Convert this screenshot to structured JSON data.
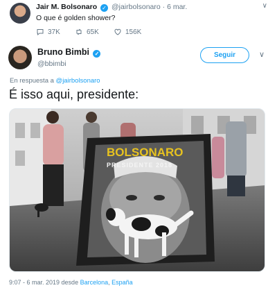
{
  "quoted": {
    "name": "Jair M. Bolsonaro",
    "handle": "@jairbolsonaro",
    "date": "· 6 mar.",
    "text": "O que é golden shower?",
    "replies": "37K",
    "retweets": "65K",
    "likes": "156K"
  },
  "main": {
    "name": "Bruno Bimbi",
    "handle": "@bbimbi",
    "follow_label": "Seguir",
    "reply_prefix": "En respuesta a",
    "reply_handle": "@jairbolsonaro",
    "text": "É isso aqui, presidente:",
    "media": {
      "sign_line1": "BOLSONARO",
      "sign_line2": "PRESIDENTE 2018"
    },
    "time": "9:07 - 6 mar. 2019 desde",
    "place_city": "Barcelona",
    "place_sep": ",",
    "place_country": "España"
  },
  "icons": {
    "verified": "verified-check-icon",
    "reply": "reply-bubble-icon",
    "retweet": "retweet-arrows-icon",
    "like": "heart-icon",
    "more": "chevron-down-icon"
  },
  "colors": {
    "accent": "#1da1f2",
    "muted": "#657786",
    "text": "#14171a"
  }
}
